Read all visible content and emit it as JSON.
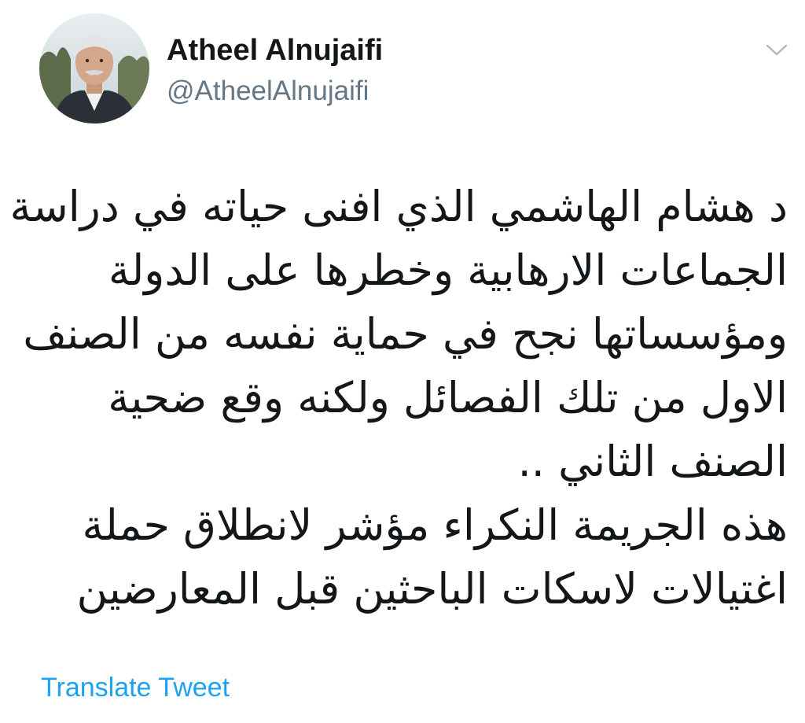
{
  "author": {
    "display_name": "Atheel Alnujaifi",
    "handle": "@AtheelAlnujaifi",
    "avatar_icon": "profile-photo"
  },
  "menu": {
    "icon": "chevron-down-icon"
  },
  "tweet": {
    "lines": [
      "د هشام الهاشمي الذي افنى حياته في دراسة",
      "الجماعات الارهابية وخطرها على الدولة",
      "ومؤسساتها نجح في حماية نفسه من الصنف",
      "الاول من تلك الفصائل ولكنه وقع ضحية",
      "الصنف الثاني ..",
      "هذه الجريمة النكراء مؤشر لانطلاق حملة",
      "اغتيالات لاسكات الباحثين قبل المعارضين"
    ]
  },
  "actions": {
    "translate_label": "Translate Tweet"
  },
  "colors": {
    "text": "#14171a",
    "secondary": "#657786",
    "link": "#1da1f2",
    "caret": "#aab8c2"
  }
}
